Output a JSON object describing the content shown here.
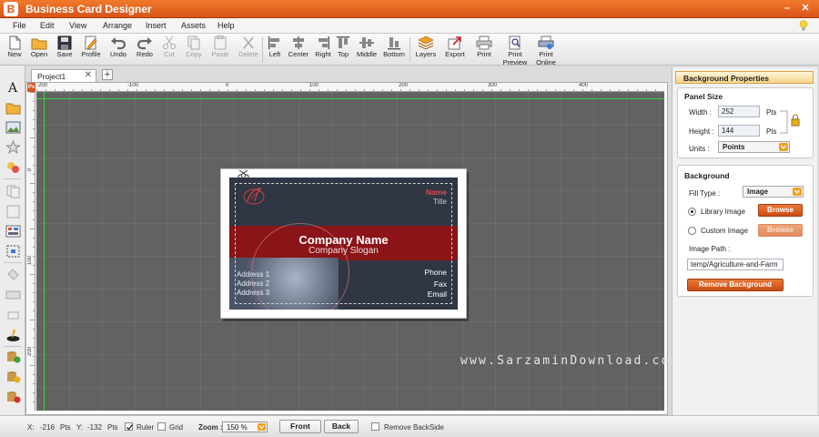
{
  "window": {
    "logo_letter": "B",
    "title": "Business Card Designer",
    "minimize": "–",
    "close": "✕"
  },
  "menu": [
    "File",
    "Edit",
    "View",
    "Arrange",
    "Insert",
    "Assets",
    "Help"
  ],
  "toolbar": {
    "new": "New",
    "open": "Open",
    "save": "Save",
    "profile": "Profile",
    "undo": "Undo",
    "redo": "Redo",
    "cut": "Cut",
    "copy": "Copy",
    "paste": "Paste",
    "delete": "Delete",
    "left": "Left",
    "center": "Center",
    "right": "Right",
    "top": "Top",
    "middle": "Middle",
    "bottom": "Bottom",
    "layers": "Layers",
    "export": "Export",
    "print": "Print",
    "print_preview_1": "Print",
    "print_preview_2": "Preview",
    "print_online_1": "Print",
    "print_online_2": "Online"
  },
  "tabs": {
    "active": "Project1",
    "close": "✕",
    "add": "+"
  },
  "rulers": {
    "corner": "Px",
    "horizontal": [
      {
        "label": "200"
      },
      {
        "label": "-100"
      },
      {
        "label": "0"
      },
      {
        "label": "100"
      },
      {
        "label": "200"
      },
      {
        "label": "300"
      },
      {
        "label": "400"
      }
    ],
    "vertical": [
      {
        "label": "0"
      },
      {
        "label": "100"
      },
      {
        "label": "200"
      }
    ]
  },
  "card": {
    "name": "Name",
    "title": "Title",
    "company": "Company Name",
    "slogan": "Company Slogan",
    "phone": "Phone",
    "fax": "Fax",
    "email": "Email",
    "address1": "Address 1",
    "address2": "Address 2",
    "address3": "Address 3"
  },
  "watermark": "www.SarzaminDownload.com",
  "panel": {
    "header": "Background Properties",
    "panel_size": {
      "title": "Panel Size",
      "width_label": "Width :",
      "width_value": "252",
      "height_label": "Height :",
      "height_value": "144",
      "units_label": "Pts",
      "units_field_label": "Units :",
      "units_value": "Points"
    },
    "background": {
      "title": "Background",
      "fill_type_label": "Fill Type :",
      "fill_type_value": "Image",
      "library_image": "Library Image",
      "custom_image": "Custom Image",
      "browse": "Browse",
      "image_path_label": "Image Path :",
      "image_path_value": "temp/Agriculture-and-Farm",
      "remove": "Remove Background"
    }
  },
  "status": {
    "x_label": "X:",
    "x_value": "-216",
    "pts1": "Pts",
    "y_label": "Y:",
    "y_value": "-132",
    "pts2": "Pts",
    "ruler": "Ruler",
    "grid": "Grid",
    "zoom_label": "Zoom :",
    "zoom_value": "150 %",
    "front": "Front",
    "back": "Back",
    "remove_backside": "Remove BackSide"
  },
  "colors": {
    "accent": "#d8541a",
    "card_bg": "#2f3644",
    "card_band": "#8a1418"
  }
}
